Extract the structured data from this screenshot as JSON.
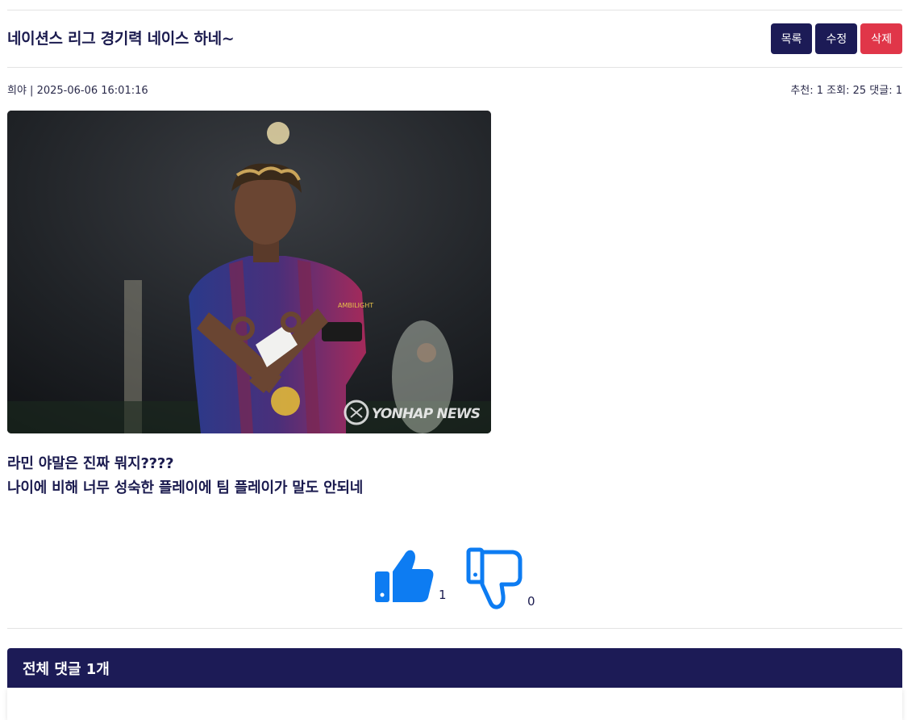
{
  "post": {
    "title": "네이션스 리그 경기력 네이스 하네~",
    "author_date": "희야 | 2025-06-06 16:01:16",
    "stats": "추천: 1 조회: 25 댓글: 1",
    "body_line1": "라민 야말은 진짜 뭐지????",
    "body_line2": "나이에 비해 너무 성숙한 플레이에 팀 플레이가 말도 안되네",
    "image_watermark": "YONHAP NEWS",
    "jersey_text": "AMBILIGHT"
  },
  "actions": {
    "list_label": "목록",
    "edit_label": "수정",
    "delete_label": "삭제"
  },
  "votes": {
    "like_count": "1",
    "dislike_count": "0"
  },
  "comments": {
    "header": "전체 댓글 1개"
  },
  "colors": {
    "navy": "#1c1b56",
    "danger": "#e03649",
    "vote_blue": "#0d7cf2"
  },
  "icons": [
    "thumbs-up-icon",
    "thumbs-down-icon",
    "yonhap-logo-icon"
  ]
}
